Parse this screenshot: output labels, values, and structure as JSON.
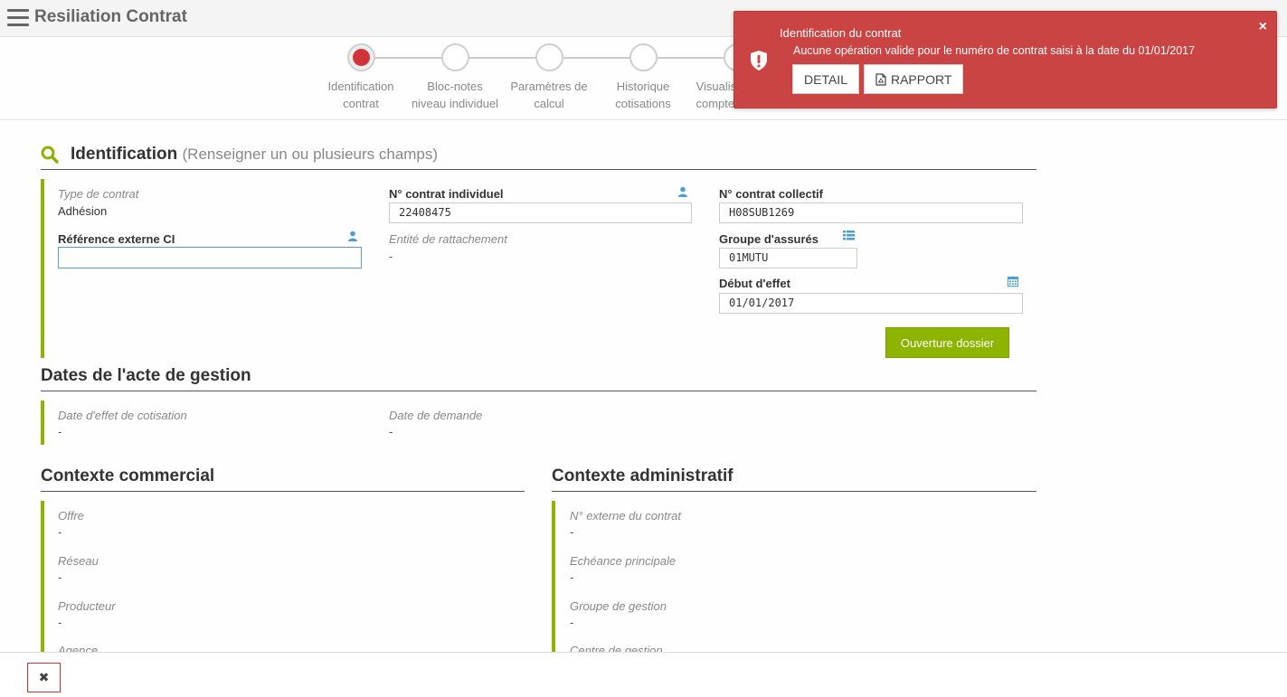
{
  "header": {
    "title": "Resiliation Contrat"
  },
  "stepper": {
    "steps": [
      {
        "line1": "Identification",
        "line2": "contrat"
      },
      {
        "line1": "Bloc-notes",
        "line2": "niveau individuel"
      },
      {
        "line1": "Paramètres de",
        "line2": "calcul"
      },
      {
        "line1": "Historique",
        "line2": "cotisations"
      },
      {
        "line1": "Visualisation du",
        "line2": "compte cotisant"
      }
    ]
  },
  "toast": {
    "title": "Identification du contrat",
    "message": "Aucune opération valide pour le numéro de contrat saisi à la date du 01/01/2017",
    "detail_label": "DETAIL",
    "rapport_label": "RAPPORT",
    "close": "×"
  },
  "identification": {
    "title": "Identification",
    "subtitle": "(Renseigner un ou plusieurs champs)",
    "type_contrat_label": "Type de contrat",
    "type_contrat_value": "Adhésion",
    "ref_externe_label": "Référence externe CI",
    "ref_externe_value": "",
    "contrat_indiv_label": "N° contrat individuel",
    "contrat_indiv_value": "22408475",
    "entite_label": "Entité de rattachement",
    "entite_value": "-",
    "contrat_coll_label": "N° contrat collectif",
    "contrat_coll_value": "H08SUB1269",
    "groupe_label": "Groupe d'assurés",
    "groupe_value": "01MUTU",
    "debut_label": "Début d'effet",
    "debut_value": "01/01/2017",
    "ouverture_label": "Ouverture dossier"
  },
  "dates": {
    "title": "Dates de l'acte de gestion",
    "effet_label": "Date d'effet de cotisation",
    "effet_value": "-",
    "demande_label": "Date de demande",
    "demande_value": "-"
  },
  "commercial": {
    "title": "Contexte commercial",
    "fields": [
      {
        "label": "Offre",
        "value": "-"
      },
      {
        "label": "Réseau",
        "value": "-"
      },
      {
        "label": "Producteur",
        "value": "-"
      },
      {
        "label": "Agence",
        "value": ""
      }
    ]
  },
  "administratif": {
    "title": "Contexte administratif",
    "fields": [
      {
        "label": "N° externe du contrat",
        "value": "-"
      },
      {
        "label": "Echéance principale",
        "value": "-"
      },
      {
        "label": "Groupe de gestion",
        "value": "-"
      },
      {
        "label": "Centre de gestion",
        "value": ""
      }
    ]
  },
  "footer": {
    "close_label": "✖"
  },
  "colors": {
    "accent": "#8cb400",
    "error": "#c94442",
    "active_step": "#d13438"
  }
}
